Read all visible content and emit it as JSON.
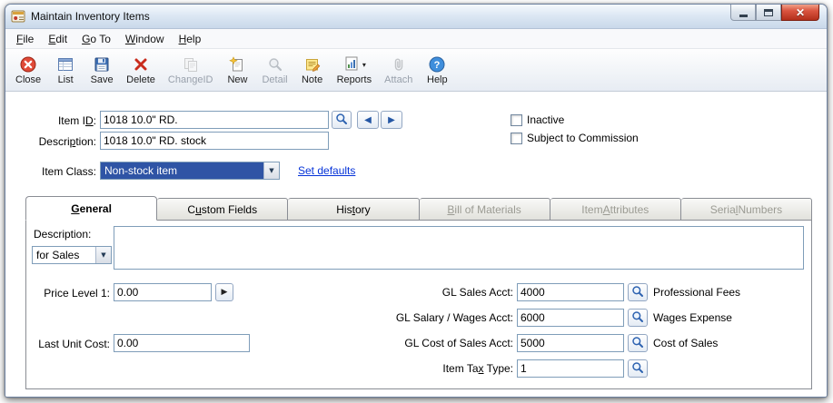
{
  "window": {
    "title": "Maintain Inventory Items"
  },
  "icons": {
    "close_window": "✕",
    "dropdown": "▼",
    "reports_dropdown": "▾",
    "prev": "◀",
    "next": "▶",
    "price_expand": "▶"
  },
  "menubar": {
    "items": [
      {
        "label": "File",
        "accel": 0
      },
      {
        "label": "Edit",
        "accel": 0
      },
      {
        "label": "Go To",
        "accel": 0
      },
      {
        "label": "Window",
        "accel": 0
      },
      {
        "label": "Help",
        "accel": 0
      }
    ]
  },
  "toolbar": {
    "buttons": [
      {
        "label": "Close",
        "icon": "close-icon",
        "disabled": false
      },
      {
        "label": "List",
        "icon": "list-icon",
        "disabled": false
      },
      {
        "label": "Save",
        "icon": "save-icon",
        "disabled": false
      },
      {
        "label": "Delete",
        "icon": "delete-icon",
        "disabled": false
      },
      {
        "label": "ChangeID",
        "icon": "change-id-icon",
        "disabled": true
      },
      {
        "label": "New",
        "icon": "new-icon",
        "disabled": false
      },
      {
        "label": "Detail",
        "icon": "detail-icon",
        "disabled": true
      },
      {
        "label": "Note",
        "icon": "note-icon",
        "disabled": false
      },
      {
        "label": "Reports",
        "icon": "reports-icon",
        "disabled": false,
        "has_dropdown": true
      },
      {
        "label": "Attach",
        "icon": "attach-icon",
        "disabled": true
      },
      {
        "label": "Help",
        "icon": "help-icon",
        "disabled": false
      }
    ]
  },
  "header": {
    "item_id": {
      "label": "Item ID:",
      "accel": 6,
      "value": "1018 10.0\" RD."
    },
    "description": {
      "label": "Description:",
      "accel": 6,
      "value": "1018 10.0\" RD. stock"
    },
    "item_class": {
      "label": "Item Class:",
      "value": "Non-stock item"
    },
    "set_defaults_link": "Set defaults",
    "checkboxes": [
      {
        "label": "Inactive",
        "checked": false
      },
      {
        "label": "Subject to Commission",
        "checked": false
      }
    ]
  },
  "tabs": [
    {
      "label": "General",
      "accel": 0,
      "active": true,
      "disabled": false
    },
    {
      "label": "Custom Fields",
      "accel": 1,
      "active": false,
      "disabled": false
    },
    {
      "label": "History",
      "accel": 3,
      "active": false,
      "disabled": false
    },
    {
      "label": "Bill of Materials",
      "accel": 0,
      "active": false,
      "disabled": true
    },
    {
      "label": "Item Attributes",
      "accel": 5,
      "active": false,
      "disabled": true
    },
    {
      "label": "Serial Numbers",
      "accel": 5,
      "active": false,
      "disabled": true
    }
  ],
  "general_tab": {
    "description": {
      "label": "Description:",
      "selector_value": "for Sales",
      "text": ""
    },
    "price_level": {
      "label": "Price Level 1:",
      "value": "0.00"
    },
    "last_unit_cost": {
      "label": "Last Unit Cost:",
      "value": "0.00"
    },
    "gl_sales": {
      "label": "GL Sales Acct:",
      "value": "4000",
      "account_name": "Professional Fees"
    },
    "gl_salary": {
      "label": "GL Salary / Wages Acct:",
      "value": "6000",
      "account_name": "Wages Expense"
    },
    "gl_cost": {
      "label": "GL Cost of Sales Acct:",
      "value": "5000",
      "account_name": "Cost of Sales"
    },
    "item_tax_type": {
      "label": "Item Tax Type:",
      "accel": 7,
      "value": "1"
    }
  }
}
